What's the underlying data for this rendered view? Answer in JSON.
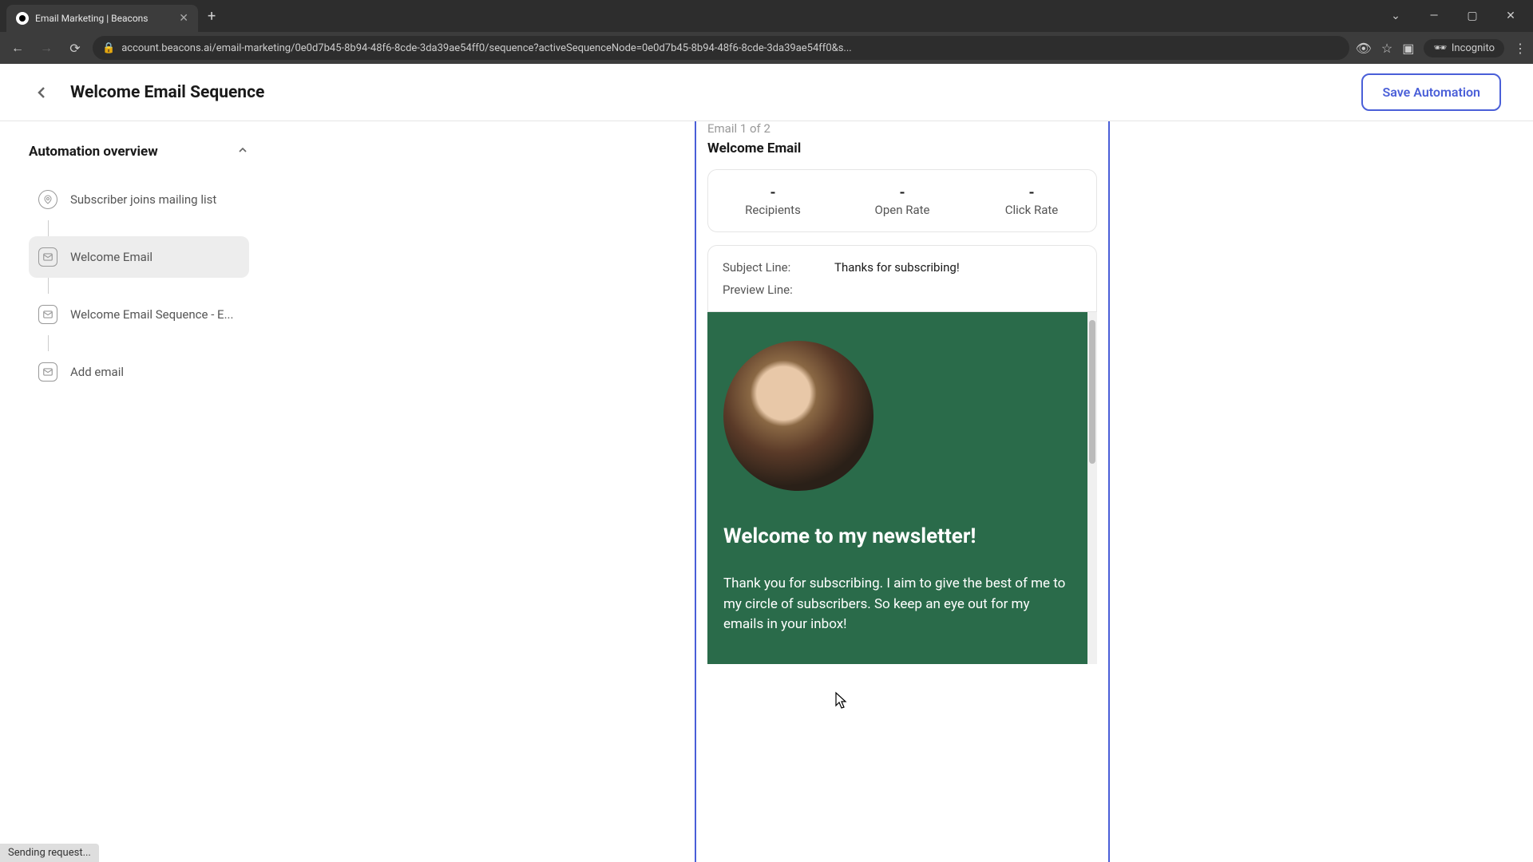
{
  "browser": {
    "tab_title": "Email Marketing | Beacons",
    "url": "account.beacons.ai/email-marketing/0e0d7b45-8b94-48f6-8cde-3da39ae54ff0/sequence?activeSequenceNode=0e0d7b45-8b94-48f6-8cde-3da39ae54ff0&s...",
    "incognito_label": "Incognito"
  },
  "header": {
    "title": "Welcome Email Sequence",
    "save_button": "Save Automation"
  },
  "overview": {
    "title": "Automation overview",
    "steps": [
      {
        "label": "Subscriber joins mailing list",
        "icon": "pin"
      },
      {
        "label": "Welcome Email",
        "icon": "mail",
        "active": true
      },
      {
        "label": "Welcome Email Sequence - E...",
        "icon": "mail"
      },
      {
        "label": "Add email",
        "icon": "mail"
      }
    ]
  },
  "email": {
    "count_label": "Email 1 of 2",
    "name": "Welcome Email",
    "stats": {
      "recipients": {
        "value": "-",
        "label": "Recipients"
      },
      "open_rate": {
        "value": "-",
        "label": "Open Rate"
      },
      "click_rate": {
        "value": "-",
        "label": "Click Rate"
      }
    },
    "subject_label": "Subject Line:",
    "subject_value": "Thanks for subscribing!",
    "preview_label": "Preview Line:",
    "preview_value": ""
  },
  "preview": {
    "heading": "Welcome to my newsletter!",
    "body": "Thank you for subscribing. I aim to give the best of me to my circle of subscribers. So keep an eye out for my emails in your inbox!"
  },
  "status": "Sending request...",
  "colors": {
    "accent": "#4a5fd8",
    "preview_bg": "#2a6b4a"
  }
}
